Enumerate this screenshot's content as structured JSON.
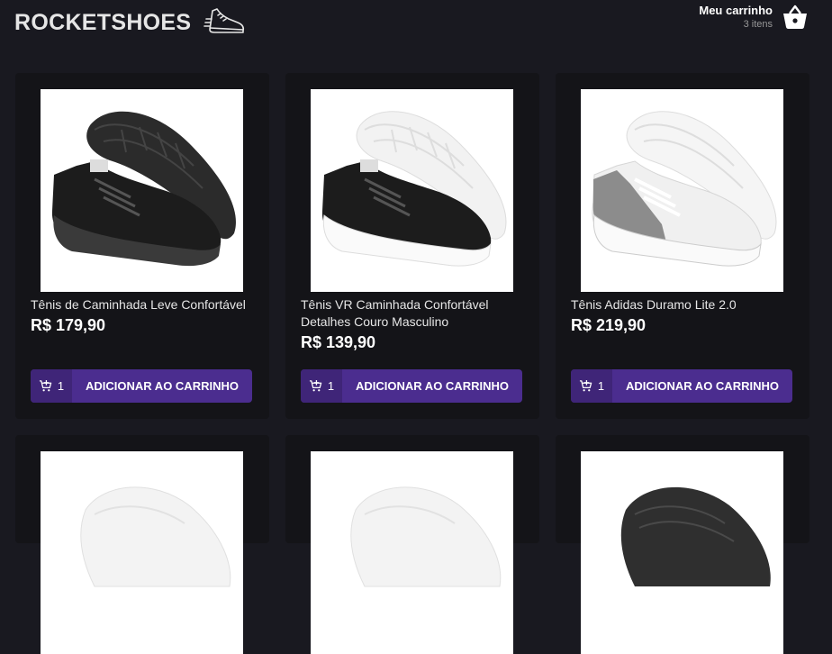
{
  "header": {
    "logo_text": "ROCKETSHOES",
    "cart_title": "Meu carrinho",
    "cart_count": "3 itens"
  },
  "products": [
    {
      "title": "Tênis de Caminhada Leve Confortável",
      "price": "R$ 179,90",
      "qty": "1",
      "button": "ADICIONAR AO CARRINHO",
      "shoe": "black-shoe"
    },
    {
      "title": "Tênis VR Caminhada Confortável Detalhes Couro Masculino",
      "price": "R$ 139,90",
      "qty": "1",
      "button": "ADICIONAR AO CARRINHO",
      "shoe": "black-white-shoe"
    },
    {
      "title": "Tênis Adidas Duramo Lite 2.0",
      "price": "R$ 219,90",
      "qty": "1",
      "button": "ADICIONAR AO CARRINHO",
      "shoe": "white-shoe"
    },
    {
      "shoe": "white-shoe"
    },
    {
      "shoe": "white-shoe"
    },
    {
      "shoe": "black-shoe"
    }
  ],
  "colors": {
    "background": "#191920",
    "card": "#141418",
    "button": "#4b2d8f",
    "button_dark": "#3f2578"
  }
}
